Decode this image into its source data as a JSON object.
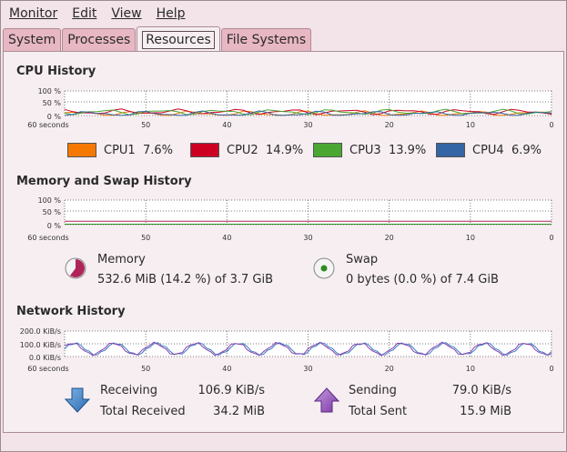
{
  "menubar": {
    "items": [
      {
        "label": "Monitor"
      },
      {
        "label": "Edit"
      },
      {
        "label": "View"
      },
      {
        "label": "Help"
      }
    ]
  },
  "tabs": [
    {
      "label": "System",
      "active": false
    },
    {
      "label": "Processes",
      "active": false
    },
    {
      "label": "Resources",
      "active": true
    },
    {
      "label": "File Systems",
      "active": false
    }
  ],
  "cpu": {
    "title": "CPU History",
    "y_ticks": [
      "100 %",
      "50 %",
      "0 %"
    ],
    "x_ticks": [
      "60 seconds",
      "50",
      "40",
      "30",
      "20",
      "10",
      "0"
    ],
    "legend": [
      {
        "name": "CPU1",
        "value": "7.6%",
        "color": "#f57900"
      },
      {
        "name": "CPU2",
        "value": "14.9%",
        "color": "#cc0022"
      },
      {
        "name": "CPU3",
        "value": "13.9%",
        "color": "#4aa832"
      },
      {
        "name": "CPU4",
        "value": "6.9%",
        "color": "#3465a4"
      }
    ]
  },
  "memory": {
    "title": "Memory and Swap History",
    "y_ticks": [
      "100 %",
      "50 %",
      "0 %"
    ],
    "x_ticks": [
      "60 seconds",
      "50",
      "40",
      "30",
      "20",
      "10",
      "0"
    ],
    "memory_label": "Memory",
    "memory_value": "532.6 MiB (14.2 %) of 3.7 GiB",
    "memory_color": "#b0245a",
    "swap_label": "Swap",
    "swap_value": "0 bytes (0.0 %) of 7.4 GiB",
    "swap_color": "#2e8b22"
  },
  "network": {
    "title": "Network History",
    "y_ticks": [
      "200.0 KiB/s",
      "100.0 KiB/s",
      "0.0 KiB/s"
    ],
    "x_ticks": [
      "60 seconds",
      "50",
      "40",
      "30",
      "20",
      "10",
      "0"
    ],
    "receiving_label": "Receiving",
    "receiving_value": "106.9 KiB/s",
    "total_received_label": "Total Received",
    "total_received_value": "34.2 MiB",
    "sending_label": "Sending",
    "sending_value": "79.0 KiB/s",
    "total_sent_label": "Total Sent",
    "total_sent_value": "15.9 MiB",
    "receiving_color": "#3a7fc0",
    "sending_color": "#8a3fb0"
  }
}
